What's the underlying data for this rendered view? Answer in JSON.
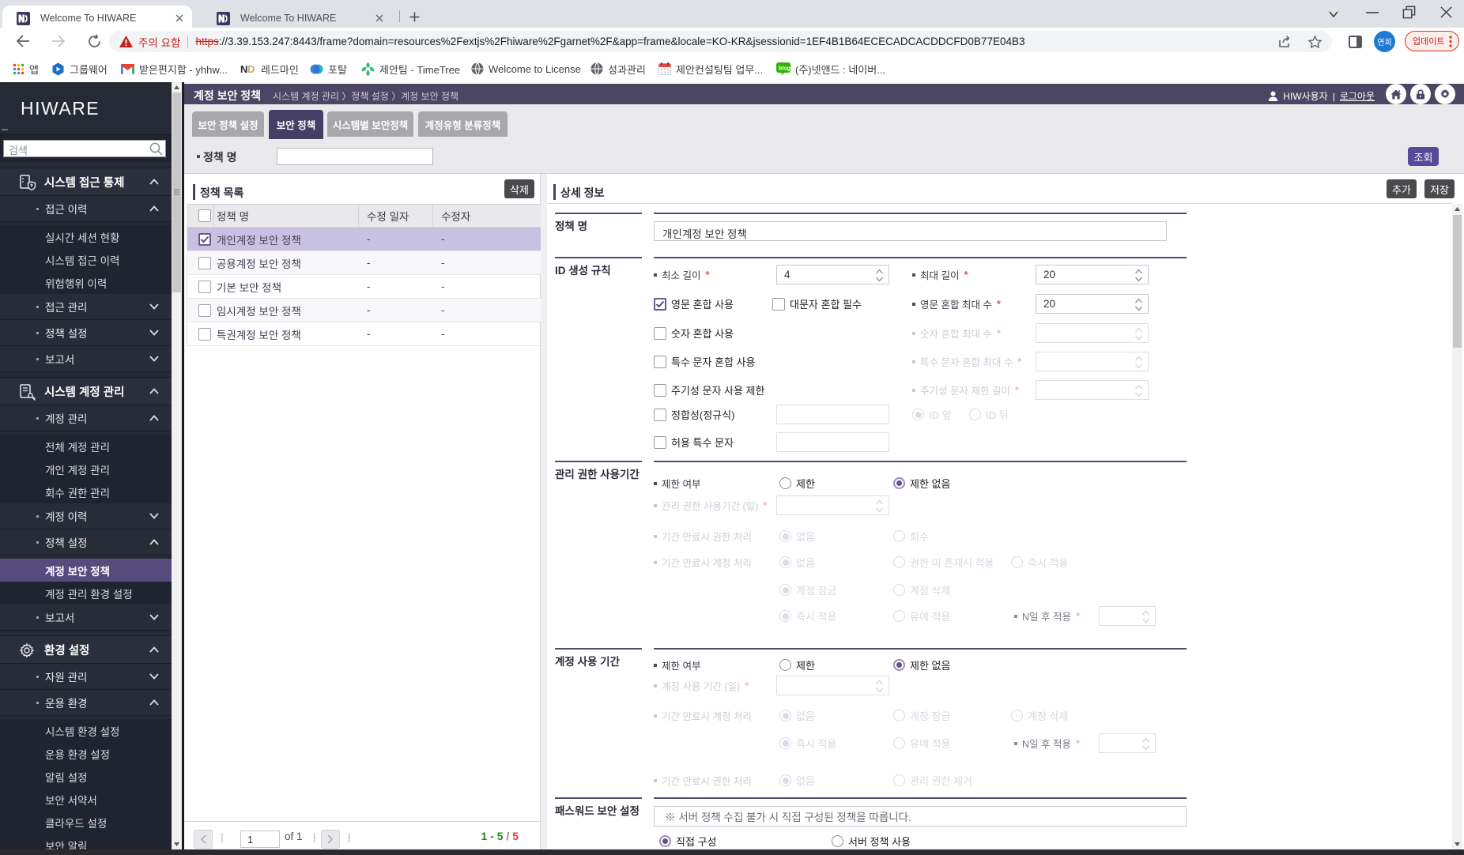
{
  "ui": {
    "required_mark": "*",
    "pipe": "|",
    "notice_prefix": "※"
  },
  "browser": {
    "tabs": [
      {
        "title": "Welcome To HIWARE",
        "favicon_text": "ND"
      },
      {
        "title": "Welcome To HIWARE",
        "favicon_text": "ND"
      }
    ],
    "url": {
      "warning": "주의 요함",
      "scheme": "https",
      "rest": "://3.39.153.247:8443/frame?domain=resources%2Fextjs%2Fhiware%2Fgarnet%2F&app=frame&locale=KO-KR&jsessionid=1EF4B1B64ECECADCACDDCFD0B77E04B3"
    },
    "avatar": "연희",
    "update_button": "업데이트",
    "bookmarks": [
      {
        "label": "앱"
      },
      {
        "label": "그룹웨어"
      },
      {
        "label": "받은편지함 - yhhw..."
      },
      {
        "label": "레드마인"
      },
      {
        "label": "포탈"
      },
      {
        "label": "제안팀 - TimeTree"
      },
      {
        "label": "Welcome to License"
      },
      {
        "label": "성과관리"
      },
      {
        "label": "제안컨설팅팀 업무..."
      },
      {
        "label": "(주)넷앤드 : 네이버..."
      }
    ]
  },
  "sidebar": {
    "logo": "HIWARE",
    "search_placeholder": "검색",
    "menu": [
      {
        "label": "시스템 접근 통제"
      },
      {
        "label": "접근 이력"
      },
      {
        "label": "실시간 세션 현황"
      },
      {
        "label": "시스템 접근 이력"
      },
      {
        "label": "위험행위 이력"
      },
      {
        "label": "접근 관리"
      },
      {
        "label": "정책 설정"
      },
      {
        "label": "보고서"
      },
      {
        "label": "시스템 계정 관리"
      },
      {
        "label": "계정 관리"
      },
      {
        "label": "전체 계정 관리"
      },
      {
        "label": "개인 계정 관리"
      },
      {
        "label": "회수 권한 관리"
      },
      {
        "label": "계정 이력"
      },
      {
        "label": "정책 설정"
      },
      {
        "label": "계정 보안 정책",
        "selected": true
      },
      {
        "label": "계정 관리 환경 설정"
      },
      {
        "label": "보고서"
      },
      {
        "label": "환경 설정"
      },
      {
        "label": "자원 관리"
      },
      {
        "label": "운용 환경"
      },
      {
        "label": "시스템 환경 설정"
      },
      {
        "label": "운용 환경 설정"
      },
      {
        "label": "알림 설정"
      },
      {
        "label": "보안 서약서"
      },
      {
        "label": "클라우드 설정"
      },
      {
        "label": "보안 알림"
      }
    ]
  },
  "header": {
    "title": "계정 보안 정책",
    "breadcrumb": "시스템 계정 관리 〉정책 설정 〉계정 보안 정책",
    "user": "HIW사용자",
    "logout": "로그아웃"
  },
  "tabs": [
    {
      "label": "보안 정책 설정"
    },
    {
      "label": "보안 정책"
    },
    {
      "label": "시스템별 보안정책"
    },
    {
      "label": "계정유형 분류정책"
    }
  ],
  "filter": {
    "label": "정책 명",
    "value": "",
    "search_button": "조회"
  },
  "policy_list": {
    "title": "정책 목록",
    "delete_button": "삭제",
    "columns": [
      "정책 명",
      "수정 일자",
      "수정자"
    ],
    "rows": [
      {
        "name": "개인계정 보안 정책",
        "modified_date": "-",
        "modifier": "-"
      },
      {
        "name": "공용계정 보안 정책",
        "modified_date": "-",
        "modifier": "-"
      },
      {
        "name": "기본 보안 정책",
        "modified_date": "-",
        "modifier": "-"
      },
      {
        "name": "임시계정 보안 정책",
        "modified_date": "-",
        "modifier": "-"
      },
      {
        "name": "특권계정 보안 정책",
        "modified_date": "-",
        "modifier": "-"
      }
    ],
    "pagination": {
      "page": "1",
      "of_label": "of 1",
      "range": "1 - 5",
      "sep": " / ",
      "total": "5"
    }
  },
  "detail": {
    "title": "상세 정보",
    "add_button": "추가",
    "save_button": "저장",
    "policy_name": {
      "label": "정책 명",
      "value": "개인계정 보안 정책"
    },
    "id_rule": {
      "label": "ID 생성 규칙",
      "min_len": "최소 길이",
      "min_len_value": "4",
      "max_len": "최대 길이",
      "max_len_value": "20",
      "eng_mix": "영문 혼합 사용",
      "upper_req": "대문자 혼합 필수",
      "eng_max": "영문 혼합 최대 수",
      "eng_max_value": "20",
      "num_mix": "숫자 혼합 사용",
      "num_max": "숫자 혼합 최대 수",
      "spec_mix": "특수 문자 혼합 사용",
      "spec_max": "특수 문자 혼합 최대 수",
      "cyclic": "주기성 문자 사용 제한",
      "cyclic_len": "주기성 문자 제한 길이",
      "regex": "정합성(정규식)",
      "id_front": "ID 앞",
      "id_back": "ID 뒤",
      "allowed_special": "허용 특수 문자"
    },
    "admin_period": {
      "label": "관리 권한 사용기간",
      "limit_label": "제한 여부",
      "limit": "제한",
      "no_limit": "제한 없음",
      "days": "관리 권한 사용기간 (일)",
      "expire_perm": "기간 만료시 권한 처리",
      "none": "없음",
      "revoke": "회수",
      "expire_account": "기간 만료시 계정 처리",
      "apply_no_perm": "권한 미 존재시 적용",
      "apply_now": "즉시 적용",
      "lock": "계정 잠금",
      "delete": "계정 삭제",
      "defer": "유예 적용",
      "after_n": "N일 후 적용"
    },
    "account_period": {
      "label": "계정 사용 기간",
      "limit_label": "제한 여부",
      "limit": "제한",
      "no_limit": "제한 없음",
      "days": "계정 사용 기간 (일)",
      "expire_account": "기간 만료시 계정 처리",
      "none": "없음",
      "lock": "계정 잠금",
      "delete": "계정 삭제",
      "apply_now": "즉시 적용",
      "defer": "유예 적용",
      "after_n": "N일 후 적용",
      "expire_perm": "기간 만료시 권한 처리",
      "remove_admin": "관리 권한 제거"
    },
    "password": {
      "label": "패스워드 보안 설정",
      "notice": "※ 서버 정책 수집 불가 시 직접 구성된 정책을 따릅니다.",
      "direct": "직접 구성",
      "server": "서버 정책 사용"
    }
  }
}
